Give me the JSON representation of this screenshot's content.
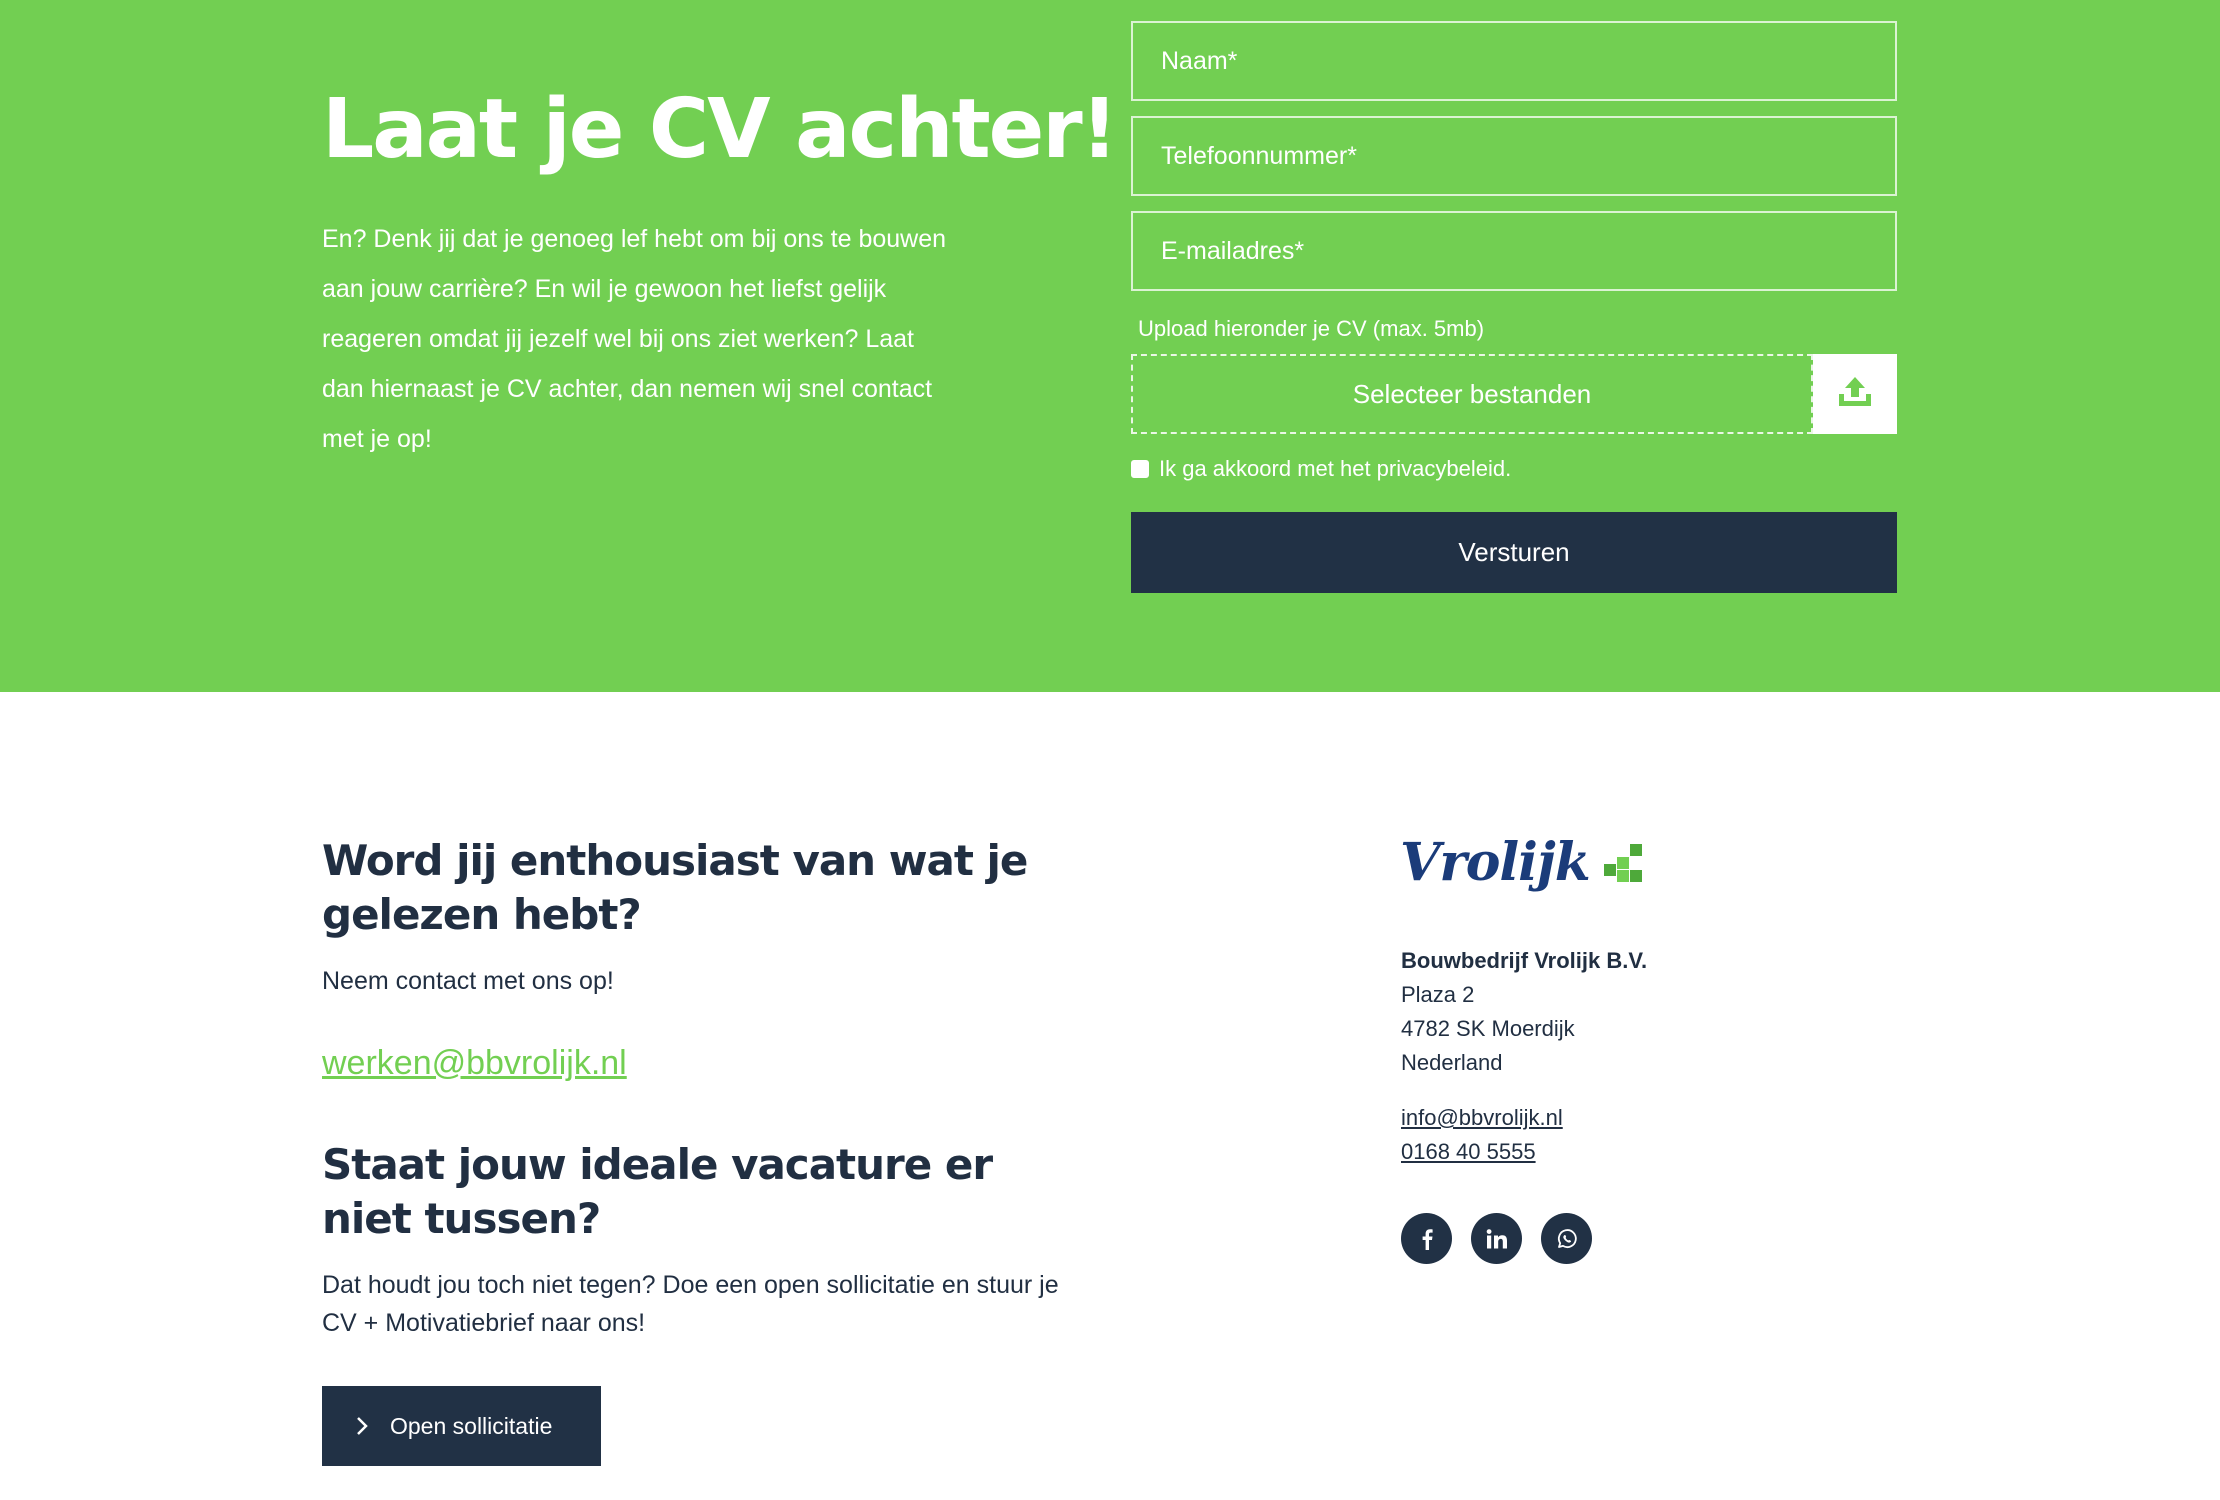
{
  "hero": {
    "title": "Laat je CV achter!",
    "text": "En? Denk jij dat je genoeg lef hebt om bij ons te bouwen aan jouw carrière? En wil je gewoon het liefst gelijk reageren omdat jij jezelf wel bij ons ziet werken? Laat dan hiernaast je CV achter, dan nemen wij snel contact met je op!"
  },
  "form": {
    "name_placeholder": "Naam*",
    "phone_placeholder": "Telefoonnummer*",
    "email_placeholder": "E-mailadres*",
    "upload_label": "Upload hieronder je CV (max. 5mb)",
    "upload_button": "Selecteer bestanden",
    "upload_icon": "upload-icon",
    "consent_label": "Ik ga akkoord met het privacybeleid.",
    "consent_checked": false,
    "submit_label": "Versturen"
  },
  "contact_section": {
    "heading": "Word jij enthousiast van wat je gelezen hebt?",
    "subtext": "Neem contact met ons op!",
    "email": "werken@bbvrolijk.nl"
  },
  "open_section": {
    "heading": "Staat jouw ideale vacature er niet tussen?",
    "text": "Dat houdt jou toch niet tegen? Doe een open sollicitatie en stuur je CV + Motivatiebrief naar ons!",
    "button_label": "Open sollicitatie",
    "button_icon": "chevron-right-icon"
  },
  "company": {
    "logo_text": "Vrolijk",
    "name": "Bouwbedrijf Vrolijk B.V.",
    "street": "Plaza 2",
    "city": "4782 SK Moerdijk",
    "country": "Nederland",
    "email": "info@bbvrolijk.nl",
    "phone": "0168 40 5555"
  },
  "socials": [
    "facebook-icon",
    "linkedin-icon",
    "whatsapp-icon"
  ],
  "colors": {
    "brand_green": "#72cf52",
    "navy": "#213145",
    "logo_blue": "#1b3c7a",
    "logo_green": "#4ea93a",
    "white": "#ffffff"
  }
}
